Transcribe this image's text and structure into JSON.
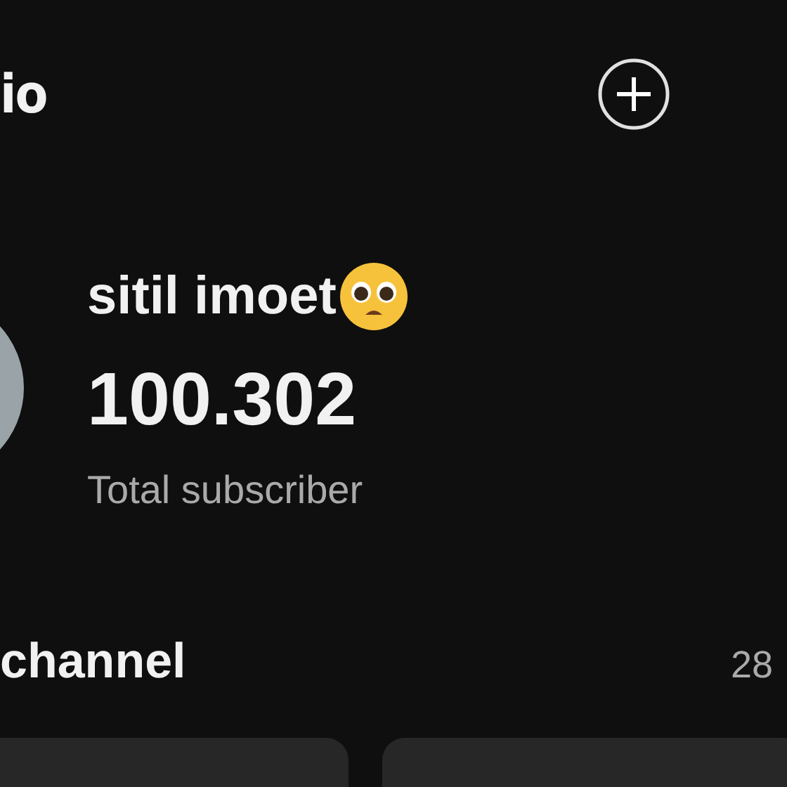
{
  "header": {
    "title": "io"
  },
  "channel": {
    "name": "sitil imoet",
    "subscribers": "100.302",
    "subscribers_label": "Total subscriber"
  },
  "section": {
    "title": "channel",
    "count": "28"
  },
  "cards": [
    {
      "kind": "card"
    },
    {
      "kind": "card"
    }
  ]
}
